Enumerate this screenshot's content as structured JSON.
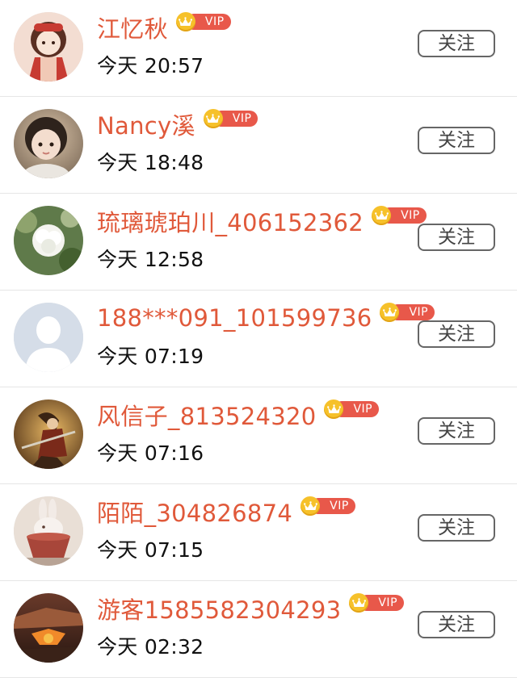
{
  "colors": {
    "name": "#e0593a",
    "vip_badge": "#e8584a",
    "vip_coin": "#f6c12a",
    "time": "#111111",
    "follow_border": "#666666",
    "divider": "#e6e6e6"
  },
  "users": [
    {
      "name": "江忆秋",
      "vip_label": "VIP",
      "time": "今天 20:57",
      "follow_label": "关注",
      "avatar": "anime-girl-avatar"
    },
    {
      "name": "Nancy溪",
      "vip_label": "VIP",
      "time": "今天 18:48",
      "follow_label": "关注",
      "avatar": "child-photo-avatar"
    },
    {
      "name": "琉璃琥珀川_406152362",
      "vip_label": "VIP",
      "time": "今天 12:58",
      "follow_label": "关注",
      "avatar": "white-flower-avatar"
    },
    {
      "name": "188***091_101599736",
      "vip_label": "VIP",
      "time": "今天 07:19",
      "follow_label": "关注",
      "avatar": "default-person-avatar"
    },
    {
      "name": "风信子_813524320",
      "vip_label": "VIP",
      "time": "今天 07:16",
      "follow_label": "关注",
      "avatar": "warrior-art-avatar"
    },
    {
      "name": "陌陌_304826874",
      "vip_label": "VIP",
      "time": "今天 07:15",
      "follow_label": "关注",
      "avatar": "rabbit-cup-avatar"
    },
    {
      "name": "游客1585582304293",
      "vip_label": "VIP",
      "time": "今天 02:32",
      "follow_label": "关注",
      "avatar": "fantasy-scene-avatar"
    }
  ]
}
